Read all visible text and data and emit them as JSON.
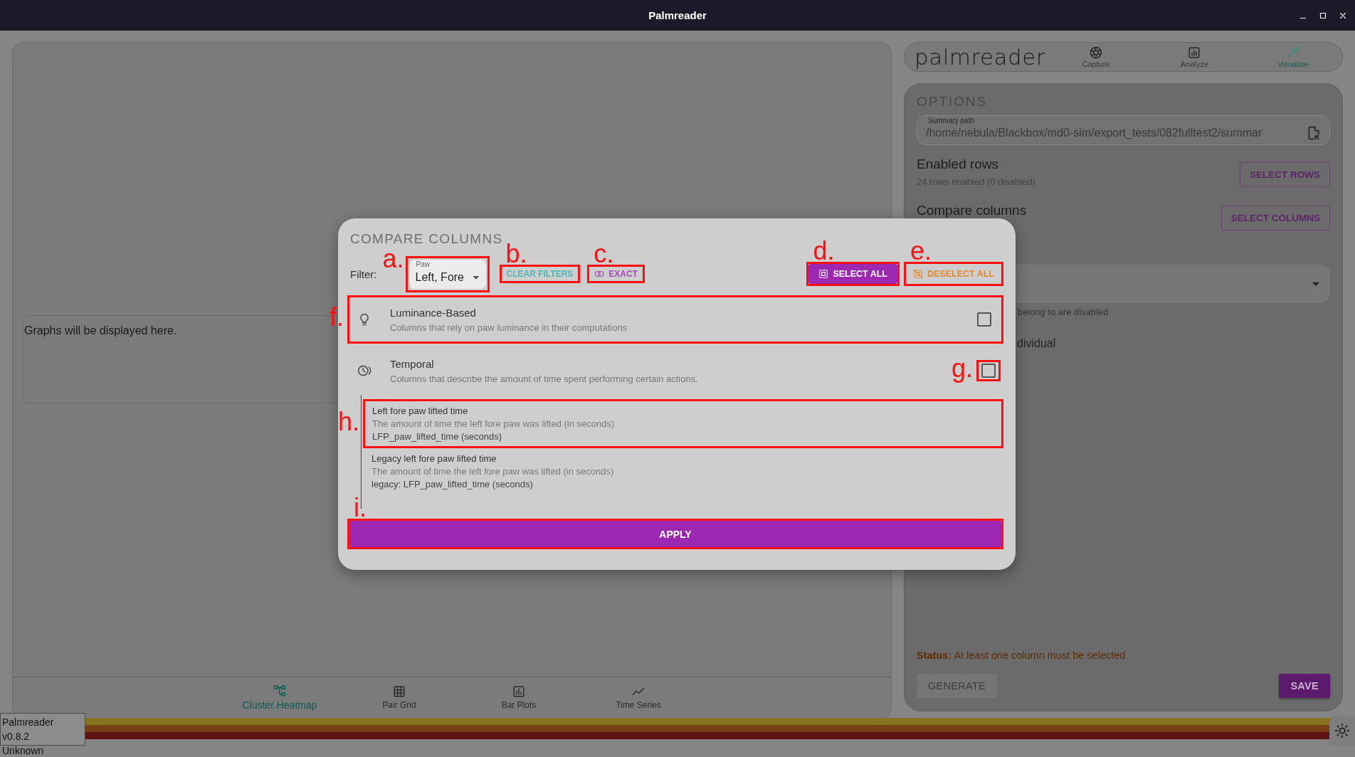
{
  "window": {
    "title": "Palmreader"
  },
  "graphs": {
    "placeholder": "Graphs will be displayed here.",
    "tabs": [
      {
        "kind": "heatmap",
        "label": "Cluster Heatmap",
        "selected": true
      },
      {
        "kind": "grid",
        "label": "Pair Grid",
        "selected": false
      },
      {
        "kind": "bars",
        "label": "Bar Plots",
        "selected": false
      },
      {
        "kind": "series",
        "label": "Time Series",
        "selected": false
      }
    ]
  },
  "app_nav": {
    "logo": "palmreader",
    "tabs": [
      {
        "kind": "capture",
        "label": "Capture",
        "selected": false
      },
      {
        "kind": "analyze",
        "label": "Analyze",
        "selected": false
      },
      {
        "kind": "visualize",
        "label": "Visualize",
        "selected": true
      }
    ]
  },
  "options": {
    "title": "OPTIONS",
    "summary_path": {
      "label": "Summary path",
      "value": "/home/nebula/Blackbox/md0-sim/export_tests/082fulltest2/summar"
    },
    "enabled_rows": {
      "title": "Enabled rows",
      "summary": "24 rows enabled (0 disabled)",
      "button": "SELECT ROWS"
    },
    "compare_columns": {
      "title": "Compare columns",
      "button": "SELECT COLUMNS"
    },
    "group_helper": "belong to are disabled",
    "individual_label": "dividual",
    "status": {
      "label": "Status:",
      "text": "At least one column must be selected"
    },
    "buttons": [
      {
        "label": "GENERATE",
        "disabled": true
      },
      {
        "label": "SAVE",
        "disabled": false
      }
    ]
  },
  "footer": {
    "version": "Palmreader v0.8.2",
    "license": "Unknown"
  },
  "dialog": {
    "title": "COMPARE COLUMNS",
    "filter_label": "Filter:",
    "filter": {
      "label": "Paw",
      "value": "Left, Fore",
      "callout": {
        "label": "a."
      }
    },
    "actions": [
      {
        "kind": "clear",
        "label": "CLEAR FILTERS",
        "callout": {
          "label": "b."
        }
      },
      {
        "kind": "exact",
        "label": "EXACT",
        "callout": {
          "label": "c."
        }
      },
      {
        "kind": "select",
        "label": "SELECT ALL",
        "callout": {
          "label": "d."
        }
      },
      {
        "kind": "deselect",
        "label": "DESELECT ALL",
        "callout": {
          "label": "e."
        }
      }
    ],
    "groups": [
      {
        "kind": "luminance",
        "title": "Luminance-Based",
        "description": "Columns that rely on paw luminance in their computations",
        "checked": false,
        "callout": {
          "label": "f."
        }
      },
      {
        "kind": "temporal",
        "title": "Temporal",
        "description": "Columns that describe the amount of time spent performing certain actions.",
        "checked": false,
        "checkbox_callout": {
          "label": "g."
        },
        "children": [
          {
            "title": "Left fore paw lifted time",
            "description": "The amount of time the left fore paw was lifted (in seconds)",
            "column": "LFP_paw_lifted_time (seconds)",
            "callout": {
              "label": "h."
            }
          },
          {
            "title": "Legacy left fore paw lifted time",
            "description": "The amount of time the left fore paw was lifted (in seconds)",
            "column": "legacy: LFP_paw_lifted_time (seconds)"
          }
        ]
      }
    ],
    "apply": {
      "label": "APPLY",
      "callout": {
        "label": "i."
      }
    }
  }
}
